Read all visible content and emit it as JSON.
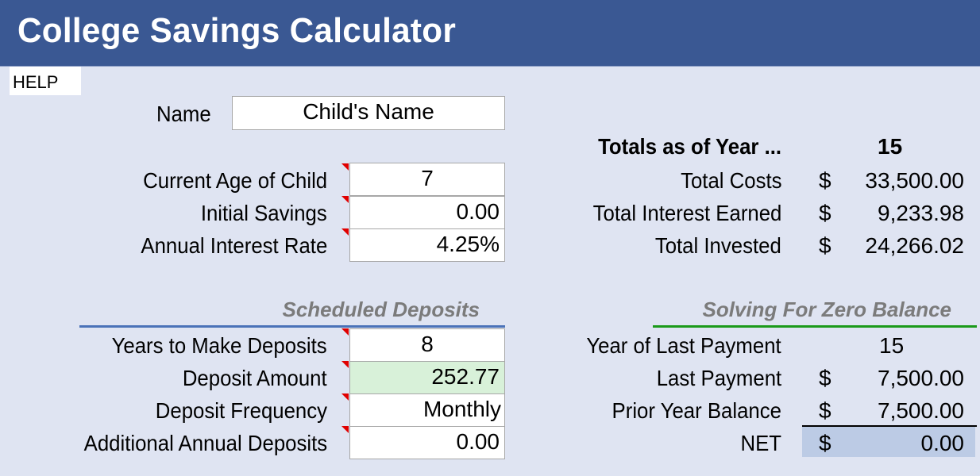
{
  "header": {
    "title": "College Savings Calculator"
  },
  "help": {
    "label": "HELP"
  },
  "inputs": {
    "name": {
      "label": "Name",
      "value": "Child's Name"
    },
    "current_age": {
      "label": "Current Age of Child",
      "value": "7"
    },
    "initial_savings": {
      "label": "Initial Savings",
      "value": "0.00"
    },
    "interest_rate": {
      "label": "Annual Interest Rate",
      "value": "4.25%"
    }
  },
  "scheduled_deposits": {
    "heading": "Scheduled Deposits",
    "years": {
      "label": "Years to Make Deposits",
      "value": "8"
    },
    "amount": {
      "label": "Deposit Amount",
      "value": "252.77"
    },
    "frequency": {
      "label": "Deposit Frequency",
      "value": "Monthly"
    },
    "additional": {
      "label": "Additional Annual Deposits",
      "value": "0.00"
    }
  },
  "totals": {
    "heading": "Totals as of Year ...",
    "year": "15",
    "currency": "$",
    "rows": [
      {
        "label": "Total Costs",
        "value": "33,500.00"
      },
      {
        "label": "Total Interest Earned",
        "value": "9,233.98"
      },
      {
        "label": "Total Invested",
        "value": "24,266.02"
      }
    ]
  },
  "zero_balance": {
    "heading": "Solving For Zero Balance",
    "currency": "$",
    "year_of_last_payment": {
      "label": "Year of Last Payment",
      "value": "15"
    },
    "last_payment": {
      "label": "Last Payment",
      "value": "7,500.00"
    },
    "prior_year_balance": {
      "label": "Prior Year Balance",
      "value": "7,500.00"
    },
    "net": {
      "label": "NET",
      "value": "0.00"
    }
  },
  "colors": {
    "header_bg": "#3a5893",
    "page_bg": "#dfe4f2",
    "blue_rule": "#4a72b8",
    "green_rule": "#1a9a1a",
    "highlight_green": "#d8f1d9",
    "net_bg": "#bccbe5",
    "comment_marker": "#e00000"
  }
}
